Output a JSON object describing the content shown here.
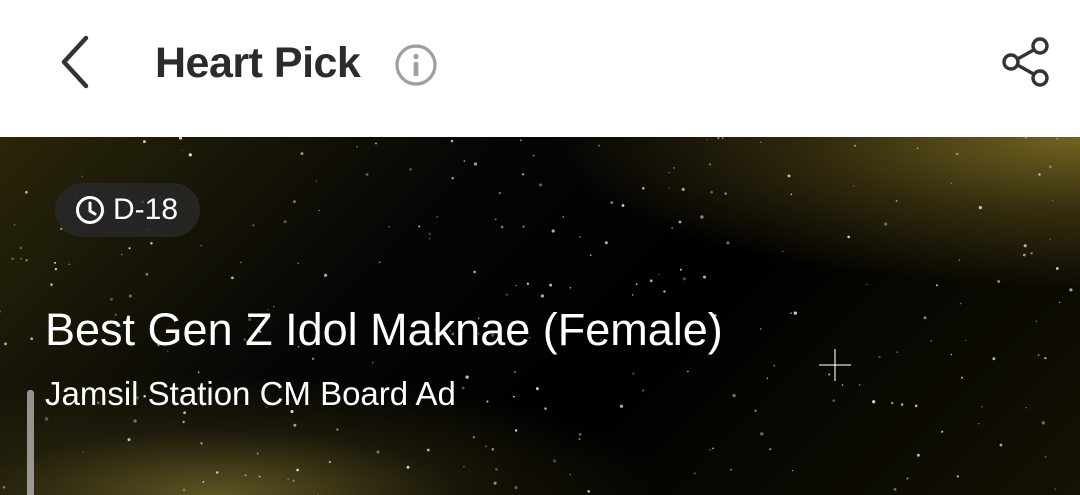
{
  "header": {
    "title": "Heart Pick",
    "back_icon": "chevron-left-icon",
    "info_icon": "info-icon",
    "share_icon": "share-icon"
  },
  "banner": {
    "dday": "D-18",
    "clock_icon": "clock-icon",
    "title": "Best Gen Z Idol Maknae (Female)",
    "subtitle": "Jamsil Station CM Board Ad"
  },
  "colors": {
    "header_bg": "#ffffff",
    "title_text": "#2b2b2b",
    "banner_gold": "#786923",
    "banner_dark": "#000000"
  }
}
